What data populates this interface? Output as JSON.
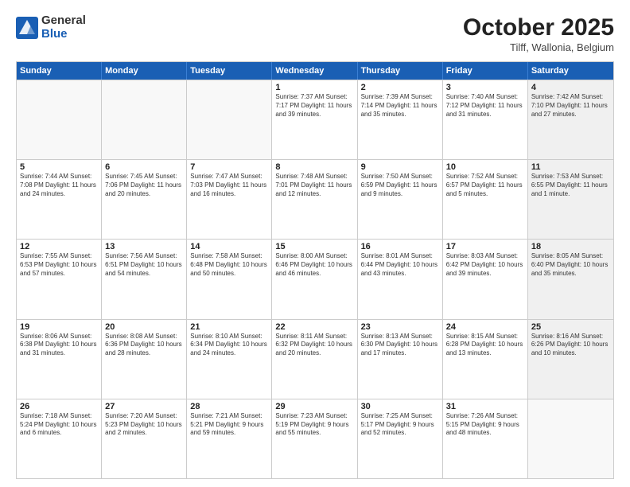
{
  "header": {
    "logo_general": "General",
    "logo_blue": "Blue",
    "month_title": "October 2025",
    "subtitle": "Tilff, Wallonia, Belgium"
  },
  "days_of_week": [
    "Sunday",
    "Monday",
    "Tuesday",
    "Wednesday",
    "Thursday",
    "Friday",
    "Saturday"
  ],
  "weeks": [
    [
      {
        "day": "",
        "info": "",
        "empty": true
      },
      {
        "day": "",
        "info": "",
        "empty": true
      },
      {
        "day": "",
        "info": "",
        "empty": true
      },
      {
        "day": "1",
        "info": "Sunrise: 7:37 AM\nSunset: 7:17 PM\nDaylight: 11 hours and 39 minutes."
      },
      {
        "day": "2",
        "info": "Sunrise: 7:39 AM\nSunset: 7:14 PM\nDaylight: 11 hours and 35 minutes."
      },
      {
        "day": "3",
        "info": "Sunrise: 7:40 AM\nSunset: 7:12 PM\nDaylight: 11 hours and 31 minutes."
      },
      {
        "day": "4",
        "info": "Sunrise: 7:42 AM\nSunset: 7:10 PM\nDaylight: 11 hours and 27 minutes.",
        "shaded": true
      }
    ],
    [
      {
        "day": "5",
        "info": "Sunrise: 7:44 AM\nSunset: 7:08 PM\nDaylight: 11 hours and 24 minutes."
      },
      {
        "day": "6",
        "info": "Sunrise: 7:45 AM\nSunset: 7:06 PM\nDaylight: 11 hours and 20 minutes."
      },
      {
        "day": "7",
        "info": "Sunrise: 7:47 AM\nSunset: 7:03 PM\nDaylight: 11 hours and 16 minutes."
      },
      {
        "day": "8",
        "info": "Sunrise: 7:48 AM\nSunset: 7:01 PM\nDaylight: 11 hours and 12 minutes."
      },
      {
        "day": "9",
        "info": "Sunrise: 7:50 AM\nSunset: 6:59 PM\nDaylight: 11 hours and 9 minutes."
      },
      {
        "day": "10",
        "info": "Sunrise: 7:52 AM\nSunset: 6:57 PM\nDaylight: 11 hours and 5 minutes."
      },
      {
        "day": "11",
        "info": "Sunrise: 7:53 AM\nSunset: 6:55 PM\nDaylight: 11 hours and 1 minute.",
        "shaded": true
      }
    ],
    [
      {
        "day": "12",
        "info": "Sunrise: 7:55 AM\nSunset: 6:53 PM\nDaylight: 10 hours and 57 minutes."
      },
      {
        "day": "13",
        "info": "Sunrise: 7:56 AM\nSunset: 6:51 PM\nDaylight: 10 hours and 54 minutes."
      },
      {
        "day": "14",
        "info": "Sunrise: 7:58 AM\nSunset: 6:48 PM\nDaylight: 10 hours and 50 minutes."
      },
      {
        "day": "15",
        "info": "Sunrise: 8:00 AM\nSunset: 6:46 PM\nDaylight: 10 hours and 46 minutes."
      },
      {
        "day": "16",
        "info": "Sunrise: 8:01 AM\nSunset: 6:44 PM\nDaylight: 10 hours and 43 minutes."
      },
      {
        "day": "17",
        "info": "Sunrise: 8:03 AM\nSunset: 6:42 PM\nDaylight: 10 hours and 39 minutes."
      },
      {
        "day": "18",
        "info": "Sunrise: 8:05 AM\nSunset: 6:40 PM\nDaylight: 10 hours and 35 minutes.",
        "shaded": true
      }
    ],
    [
      {
        "day": "19",
        "info": "Sunrise: 8:06 AM\nSunset: 6:38 PM\nDaylight: 10 hours and 31 minutes."
      },
      {
        "day": "20",
        "info": "Sunrise: 8:08 AM\nSunset: 6:36 PM\nDaylight: 10 hours and 28 minutes."
      },
      {
        "day": "21",
        "info": "Sunrise: 8:10 AM\nSunset: 6:34 PM\nDaylight: 10 hours and 24 minutes."
      },
      {
        "day": "22",
        "info": "Sunrise: 8:11 AM\nSunset: 6:32 PM\nDaylight: 10 hours and 20 minutes."
      },
      {
        "day": "23",
        "info": "Sunrise: 8:13 AM\nSunset: 6:30 PM\nDaylight: 10 hours and 17 minutes."
      },
      {
        "day": "24",
        "info": "Sunrise: 8:15 AM\nSunset: 6:28 PM\nDaylight: 10 hours and 13 minutes."
      },
      {
        "day": "25",
        "info": "Sunrise: 8:16 AM\nSunset: 6:26 PM\nDaylight: 10 hours and 10 minutes.",
        "shaded": true
      }
    ],
    [
      {
        "day": "26",
        "info": "Sunrise: 7:18 AM\nSunset: 5:24 PM\nDaylight: 10 hours and 6 minutes."
      },
      {
        "day": "27",
        "info": "Sunrise: 7:20 AM\nSunset: 5:23 PM\nDaylight: 10 hours and 2 minutes."
      },
      {
        "day": "28",
        "info": "Sunrise: 7:21 AM\nSunset: 5:21 PM\nDaylight: 9 hours and 59 minutes."
      },
      {
        "day": "29",
        "info": "Sunrise: 7:23 AM\nSunset: 5:19 PM\nDaylight: 9 hours and 55 minutes."
      },
      {
        "day": "30",
        "info": "Sunrise: 7:25 AM\nSunset: 5:17 PM\nDaylight: 9 hours and 52 minutes."
      },
      {
        "day": "31",
        "info": "Sunrise: 7:26 AM\nSunset: 5:15 PM\nDaylight: 9 hours and 48 minutes."
      },
      {
        "day": "",
        "info": "",
        "empty": true,
        "shaded": true
      }
    ]
  ]
}
